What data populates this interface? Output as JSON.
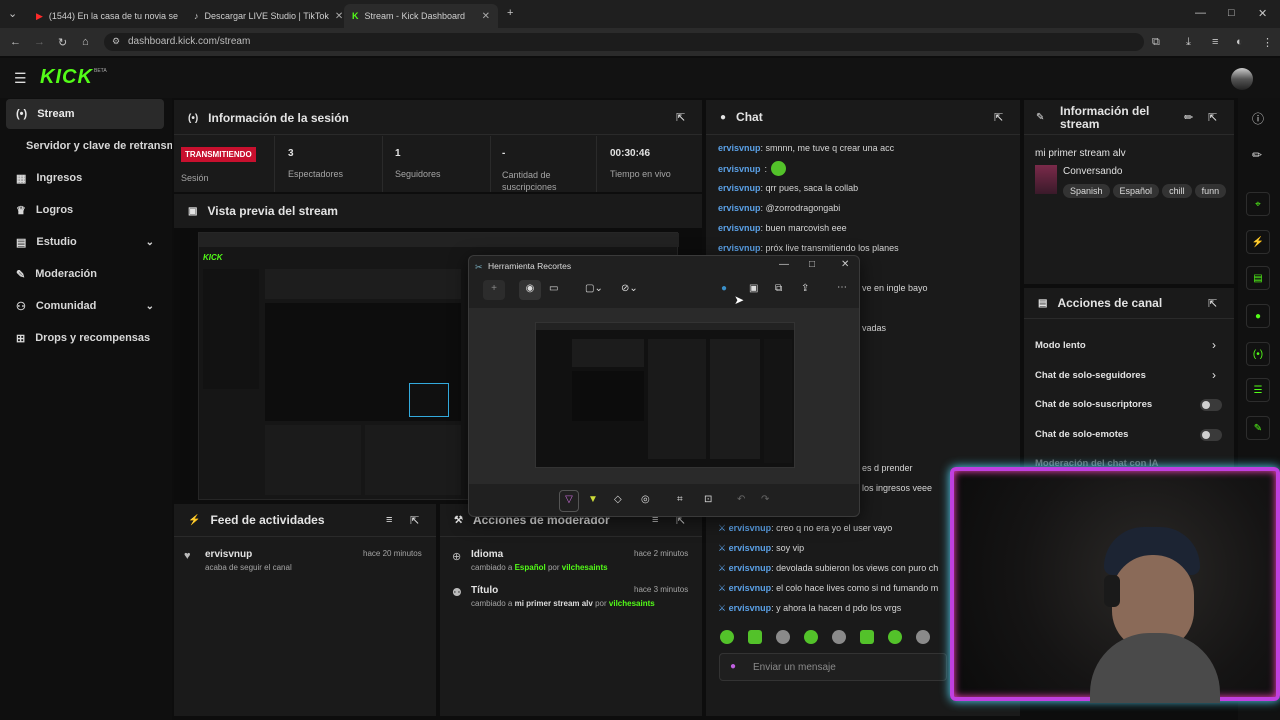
{
  "browser": {
    "tabs": [
      {
        "title": "(1544) En la casa de tu novia se",
        "icon": "youtube-icon"
      },
      {
        "title": "Descargar LIVE Studio | TikTok",
        "icon": "tiktok-icon"
      },
      {
        "title": "Stream - Kick Dashboard",
        "icon": "kick-icon"
      }
    ],
    "url": "dashboard.kick.com/stream"
  },
  "app": {
    "logo": "KICK",
    "beta": "BETA"
  },
  "sidebar": {
    "items": [
      {
        "label": "Stream",
        "icon": "broadcast-icon"
      },
      {
        "label": "Servidor y clave de retransmisión"
      },
      {
        "label": "Ingresos",
        "icon": "chart-icon"
      },
      {
        "label": "Logros",
        "icon": "trophy-icon"
      },
      {
        "label": "Estudio",
        "icon": "studio-icon"
      },
      {
        "label": "Moderación",
        "icon": "wrench-icon"
      },
      {
        "label": "Comunidad",
        "icon": "people-icon"
      },
      {
        "label": "Drops y recompensas",
        "icon": "gift-icon"
      }
    ]
  },
  "session": {
    "title": "Información de la sesión",
    "badge": "TRANSMITIENDO",
    "badge_label": "Sesión",
    "stats": [
      {
        "value": "3",
        "label": "Espectadores"
      },
      {
        "value": "1",
        "label": "Seguidores"
      },
      {
        "value": "-",
        "label": "Cantidad de suscripciones"
      },
      {
        "value": "00:30:46",
        "label": "Tiempo en vivo"
      }
    ]
  },
  "preview": {
    "title": "Vista previa del stream"
  },
  "activity": {
    "title": "Feed de actividades",
    "items": [
      {
        "user": "ervisvnup",
        "text": "acaba de seguir el canal",
        "time": "hace 20 minutos"
      }
    ]
  },
  "modactions": {
    "title": "Acciones de moderador",
    "items": [
      {
        "title": "Idioma",
        "prefix": "cambiado a",
        "value": "Español",
        "by": "por",
        "user": "vilchesaints",
        "time": "hace 2 minutos"
      },
      {
        "title": "Título",
        "prefix": "cambiado a",
        "value": "mi primer stream alv",
        "by": "por",
        "user": "vilchesaints",
        "time": "hace 3 minutos"
      }
    ]
  },
  "chat": {
    "title": "Chat",
    "messages_top": [
      {
        "user": "ervisvnup",
        "text": "smnnn, me tuve q crear una acc"
      },
      {
        "user": "ervisvnup",
        "text": ""
      },
      {
        "user": "ervisvnup",
        "text": "qrr pues, saca la collab"
      },
      {
        "user": "ervisvnup",
        "text": "@zorrodragongabi"
      },
      {
        "user": "ervisvnup",
        "text": "buen marcovish eee"
      },
      {
        "user": "ervisvnup",
        "text": "próx live transmitiendo los planes"
      }
    ],
    "partial": [
      "ve en ingle bayo",
      "vadas",
      "es d prender",
      "los ingresos veee"
    ],
    "messages_bottom": [
      {
        "user": "ervisvnup",
        "text": "creo q no era yo el user vayo"
      },
      {
        "user": "ervisvnup",
        "text": "soy vip"
      },
      {
        "user": "ervisvnup",
        "text": "devolada subieron los views con puro ch"
      },
      {
        "user": "ervisvnup",
        "text": "el colo hace lives como si nd fumando m"
      },
      {
        "user": "ervisvnup",
        "text": "y ahora la hacen d pdo los vrgs"
      }
    ],
    "placeholder": "Enviar un mensaje"
  },
  "streaminfo": {
    "title": "Información del stream",
    "stream_title": "mi primer stream alv",
    "category": "Conversando",
    "tags": [
      "Spanish",
      "Español",
      "chill",
      "funn"
    ]
  },
  "channel": {
    "title": "Acciones de canal",
    "items": [
      {
        "label": "Modo lento"
      },
      {
        "label": "Chat de solo-seguidores"
      },
      {
        "label": "Chat de solo-suscriptores"
      },
      {
        "label": "Chat de solo-emotes"
      },
      {
        "label": "Moderación del chat con IA"
      }
    ]
  },
  "snip": {
    "title": "Herramienta Recortes"
  },
  "colors": {
    "accent": "#53fc18",
    "live": "#c8102e",
    "username": "#5aa0e6",
    "bg": "#0d0d0d",
    "panel": "#1a1a1a"
  }
}
